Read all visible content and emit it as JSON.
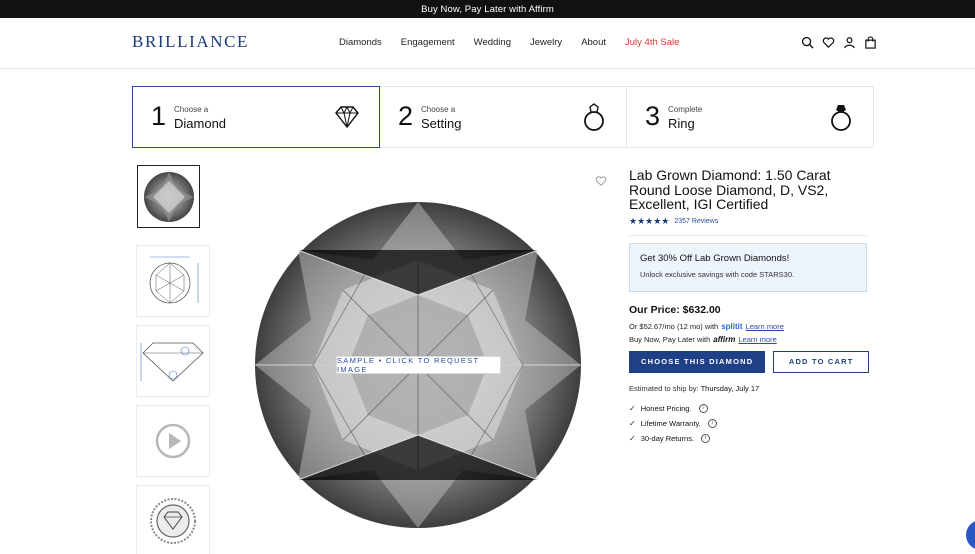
{
  "promo_bar": {
    "text": "Buy Now, Pay Later with Affirm"
  },
  "header": {
    "logo": "BRILLIANCE",
    "nav": [
      "Diamonds",
      "Engagement",
      "Wedding",
      "Jewelry",
      "About",
      "July 4th Sale"
    ],
    "icons": [
      "search-icon",
      "heart-icon",
      "account-icon",
      "bag-icon"
    ]
  },
  "steps": [
    {
      "num": "1",
      "sub": "Choose a",
      "title": "Diamond",
      "icon": "diamond-icon"
    },
    {
      "num": "2",
      "sub": "Choose a",
      "title": "Setting",
      "icon": "ring-setting-icon"
    },
    {
      "num": "3",
      "sub": "Complete",
      "title": "Ring",
      "icon": "ring-icon"
    }
  ],
  "gallery": {
    "thumbs": [
      "diamond-photo",
      "top-diagram",
      "side-diagram",
      "video",
      "certificate-seal"
    ],
    "sample_label": "SAMPLE • CLICK TO REQUEST IMAGE"
  },
  "product": {
    "title": "Lab Grown Diamond: 1.50 Carat Round Loose Diamond, D, VS2, Excellent, IGI Certified",
    "stars": "★★★★★",
    "reviews": "2357 Reviews",
    "promo_title": "Get 30% Off Lab Grown Diamonds!",
    "promo_sub": "Unlock exclusive savings with code STARS30.",
    "price": "Our Price: $632.00",
    "split_text": "Or $52.67/mo (12 mo) with",
    "split_brand": "splitit",
    "split_link": "Learn more",
    "affirm_text": "Buy Now, Pay Later with",
    "affirm_brand": "affirm",
    "affirm_link": "Learn more",
    "choose_btn": "CHOOSE THIS DIAMOND",
    "cart_btn": "ADD TO CART",
    "ship_label": "Estimated to ship by:",
    "ship_date": "Thursday, July 17",
    "features": [
      "Honest Pricing.",
      "Lifetime Warranty.",
      "30-day Returns."
    ]
  },
  "colors": {
    "brand": "#1b3a78",
    "primary_btn": "#1f3f87",
    "sale": "#d43a2f",
    "promo_bg": "#eef4fb"
  }
}
